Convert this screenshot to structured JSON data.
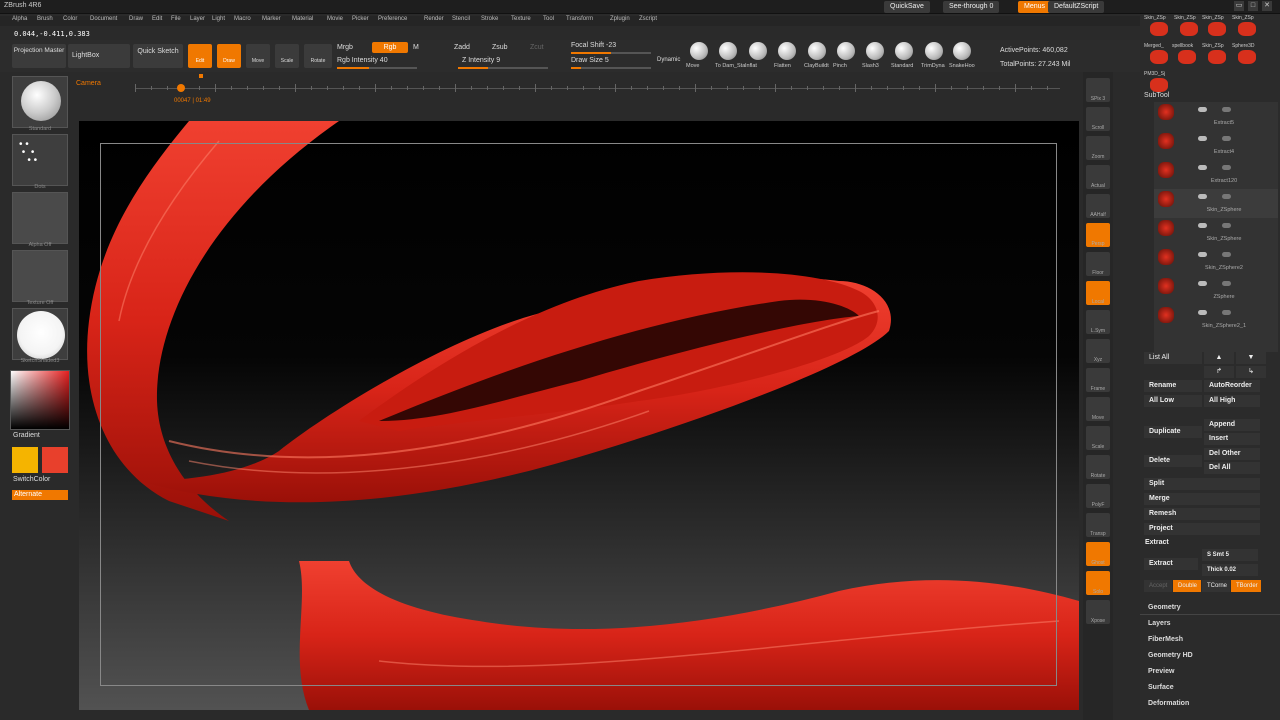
{
  "app": {
    "title": "ZBrush 4R6"
  },
  "menus": [
    "Alpha",
    "Brush",
    "Color",
    "Document",
    "Draw",
    "Edit",
    "File",
    "Layer",
    "Light",
    "Macro",
    "Marker",
    "Material",
    "Movie",
    "Picker",
    "Preference",
    "Render",
    "Stencil",
    "Stroke",
    "Texture",
    "Tool",
    "Transform",
    "Zplugin",
    "Zscript"
  ],
  "coords": "0.044,-0.411,0.383",
  "titlebar": {
    "quicksave": "QuickSave",
    "seethrough": "See-through 0",
    "menus": "Menus",
    "zscript": "DefaultZScript"
  },
  "toolbar": {
    "projection_master": "Projection Master",
    "lightbox": "LightBox",
    "quick_sketch": "Quick Sketch",
    "edit": "Edit",
    "draw": "Draw",
    "move": "Move",
    "scale": "Scale",
    "rotate": "Rotate",
    "mrgb": "Mrgb",
    "rgb": "Rgb",
    "m": "M",
    "rgb_intensity": "Rgb Intensity 40",
    "zadd": "Zadd",
    "zsub": "Zsub",
    "zcut": "Zcut",
    "z_intensity": "Z Intensity 9",
    "focal_shift": "Focal Shift -23",
    "draw_size": "Draw Size 5",
    "dynamic": "Dynamic",
    "active_points": "ActivePoints: 460,082",
    "total_points": "TotalPoints: 27.243 Mil"
  },
  "brushes": [
    "Move",
    "To Dam_Sta",
    "Inflat",
    "Flatten",
    "ClayBuildt",
    "Pinch",
    "Slash3",
    "Standard",
    "TrimDyna",
    "SnakeHoo"
  ],
  "timeline": {
    "camera": "Camera",
    "time": "00047 | 01:49"
  },
  "left_tray": {
    "standard": "Standard",
    "dots": "Dots",
    "alpha_off": "Alpha Off",
    "texture_off": "Texture Off",
    "sketch_shaded": "SketchShaded3",
    "gradient": "Gradient",
    "switch_color": "SwitchColor",
    "alternate": "Alternate"
  },
  "right_shelf": [
    "SPix 3",
    "Scroll",
    "Zoom",
    "Actual",
    "AAHalf",
    "Persp",
    "Floor",
    "Local",
    "L.Sym",
    "Xyz",
    "Frame",
    "Move",
    "Scale",
    "Rotate",
    "PolyF",
    "Transp",
    "Ghost",
    "Solo",
    "Xpose"
  ],
  "tool_thumbs": [
    "Skin_ZSp",
    "Skin_ZSp",
    "Skin_ZSp",
    "Skin_ZSp",
    "Merged_",
    "spellbook",
    "Skin_ZSp",
    "Sphere3D",
    "PM3D_Sj"
  ],
  "subtool": {
    "header": "SubTool",
    "items": [
      "Extract5",
      "Extract4",
      "Extract120",
      "Skin_ZSphere",
      "Skin_ZSphere",
      "Skin_ZSphere2",
      "ZSphere",
      "Skin_ZSphere2_1"
    ]
  },
  "panel": {
    "list_all": "List All",
    "rename": "Rename",
    "auto_reorder": "AutoReorder",
    "all_low": "All Low",
    "all_high": "All High",
    "duplicate": "Duplicate",
    "append": "Append",
    "insert": "Insert",
    "delete": "Delete",
    "del_other": "Del Other",
    "del_all": "Del All",
    "split": "Split",
    "merge": "Merge",
    "remesh": "Remesh",
    "project": "Project",
    "extract_hdr": "Extract",
    "extract": "Extract",
    "s_smt": "S Smt 5",
    "thick": "Thick 0.02",
    "accept": "Accept",
    "double": "Double",
    "tcorne": "TCorne",
    "tborder": "TBorder"
  },
  "sections": [
    "Geometry",
    "Layers",
    "FiberMesh",
    "Geometry HD",
    "Preview",
    "Surface",
    "Deformation"
  ],
  "colors": {
    "accent": "#f07800",
    "primary": "#f5b400",
    "secondary": "#e8402c",
    "mesh": "#d82418"
  }
}
